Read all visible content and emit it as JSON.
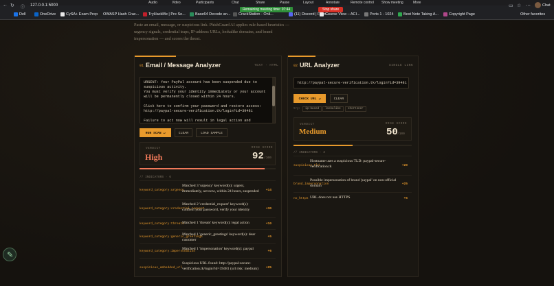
{
  "browser": {
    "url": "127.0.0.1:5000",
    "meeting_menu": [
      "Audio",
      "Video",
      "Participants",
      "Chat",
      "Share",
      "Pause",
      "Layout",
      "Annotate",
      "Remote control",
      "Show meeting",
      "More"
    ],
    "timer": "Remaining meeting time: 07:44",
    "stop_share": "Stop share",
    "profile": "Chat",
    "bookmarks": [
      {
        "label": "Dell",
        "color": "#1a73e8"
      },
      {
        "label": "OneDrive",
        "color": "#0a64c8"
      },
      {
        "label": "CySA+ Exam Prep",
        "color": "#e8e8e8"
      },
      {
        "label": "OWASP Hash Crac...",
        "color": "#202020"
      },
      {
        "label": "TryHackMe | Pre Se...",
        "color": "#c11f2b"
      },
      {
        "label": "Base64 Decode an...",
        "color": "#2a8c5a"
      },
      {
        "label": "CrackStation - Onli...",
        "color": "#555555"
      },
      {
        "label": "(11) Discord | Frien...",
        "color": "#5865f2"
      },
      {
        "label": "Course View – ACI...",
        "color": "#e8e8e8"
      },
      {
        "label": "Ports 1 - 1024",
        "color": "#777777"
      },
      {
        "label": "Best Note Taking A...",
        "color": "#2fa84f"
      },
      {
        "label": "Copyright Page",
        "color": "#b0478a"
      }
    ],
    "other_favorites": "Other favorites"
  },
  "intro": "Paste an email, message, or suspicious link. PhishGuard AI applies rule-based heuristics — urgency signals, credential traps, IP-address URLs, lookalike domains, and brand impersonation — and scores the threat.",
  "email_panel": {
    "num": "01",
    "title": "Email / Message Analyzer",
    "tag": "TEXT · HTML",
    "text": "URGENT: Your PayPal account has been suspended due to suspicious activity.\nYou must verify your identity immediately or your account will be permanently closed within 24 hours.\n\nClick here to confirm your password and restore access:\nhttp://paypal-secure-verification.tk/login?id=39481\n\nFailure to act now will result in legal action and permanent",
    "run_label": "RUN SCAN",
    "run_key": "↵",
    "clear_label": "CLEAR",
    "sample_label": "LOAD SAMPLE",
    "verdict_label": "VERDICT",
    "verdict": "High",
    "verdict_color": "#f07a5a",
    "risk_label": "RISK SCORE",
    "score": "92",
    "score_max": "/100",
    "score_fraction": 0.92,
    "indicators_label": "// INDICATORS · 6",
    "indicators": [
      {
        "cat": "keyword_category:urgency",
        "desc": "Matched 3 'urgency' keyword(s): urgent, immediately, act now, within 24 hours, suspended",
        "pts": "+14"
      },
      {
        "cat": "keyword_category:credential_request",
        "desc": "Matched 2 'credential_request' keyword(s): confirm your password, verify your identity",
        "pts": "+30"
      },
      {
        "cat": "keyword_category:threats",
        "desc": "Matched 1 'threats' keyword(s): legal action",
        "pts": "+10"
      },
      {
        "cat": "keyword_category:generic_greetings",
        "desc": "Matched 1 'generic_greetings' keyword(s): dear customer",
        "pts": "+5"
      },
      {
        "cat": "keyword_category:impersonation",
        "desc": "Matched 1 'impersonation' keyword(s): paypal",
        "pts": "+6"
      },
      {
        "cat": "suspicious_embedded_url",
        "desc": "Suspicious URL found: http://paypal-secure-verification.tk/login?id=39481 (url risk: medium)",
        "pts": "+25"
      }
    ]
  },
  "url_panel": {
    "num": "02",
    "title": "URL Analyzer",
    "tag": "SINGLE LINK",
    "url": "http://paypal-secure-verification.tk/login?id=39481",
    "check_label": "CHECK URL",
    "check_key": "↵",
    "clear_label": "CLEAR",
    "chip_prefix": "try:",
    "chips": [
      "ip-based",
      "lookalike",
      "shortener"
    ],
    "verdict_label": "VERDICT",
    "verdict": "Medium",
    "verdict_color": "#e89a2c",
    "risk_label": "RISK SCORE",
    "score": "50",
    "score_max": "/100",
    "score_fraction": 0.5,
    "indicators_label": "// INDICATORS · 3",
    "indicators": [
      {
        "cat": "suspicious_tld",
        "desc": "Hostname uses a suspicious TLD: paypal-secure-verification.tk",
        "pts": "+20"
      },
      {
        "cat": "brand_impersonation",
        "desc": "Possible impersonation of brand 'paypal' on non-official domain",
        "pts": "+25"
      },
      {
        "cat": "no_https",
        "desc": "URL does not use HTTPS",
        "pts": "+5"
      }
    ]
  }
}
